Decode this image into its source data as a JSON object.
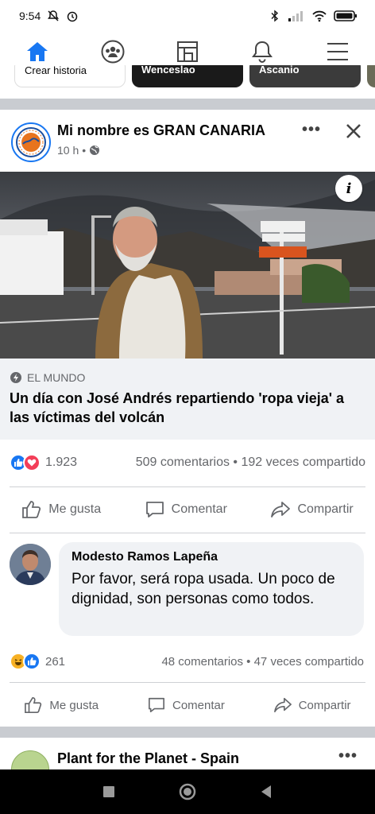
{
  "status_bar": {
    "time": "9:54"
  },
  "nav_tabs": [
    {
      "icon": "home-icon",
      "active": true
    },
    {
      "icon": "groups-icon",
      "active": false
    },
    {
      "icon": "pages-icon",
      "active": false
    },
    {
      "icon": "bell-icon",
      "active": false
    },
    {
      "icon": "menu-icon",
      "active": false
    }
  ],
  "stories": [
    "Crear historia",
    "Wenceslao",
    "Ascanio"
  ],
  "post": {
    "page_name": "Mi nombre es GRAN CANARIA",
    "time": "10 h",
    "more": "•••",
    "link": {
      "source": "EL MUNDO",
      "title": "Un día con José Andrés repartiendo 'ropa vieja' a las víctimas del volcán"
    },
    "reaction_count": "1.923",
    "engagement": "509 comentarios • 192 veces compartido",
    "actions": {
      "like": "Me gusta",
      "comment": "Comentar",
      "share": "Compartir"
    }
  },
  "comment": {
    "author": "Modesto Ramos Lapeña",
    "text": "Por favor, será ropa usada. Un poco de dignidad, son personas como todos."
  },
  "post_footer": {
    "reaction_count": "261",
    "engagement": "48 comentarios • 47 veces compartido",
    "actions": {
      "like": "Me gusta",
      "comment": "Comentar",
      "share": "Compartir"
    }
  },
  "next_post": {
    "page_name": "Plant for the Planet - Spain",
    "more": "•••"
  },
  "colors": {
    "accent": "#1877f2",
    "separator": "#c9ccd1",
    "secondary_text": "#65676b"
  }
}
